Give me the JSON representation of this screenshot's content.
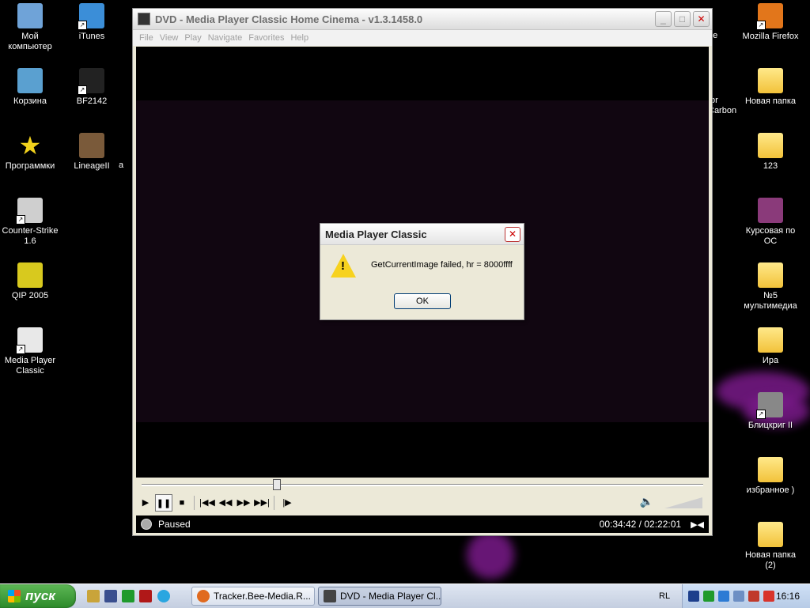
{
  "desktop": {
    "icons_left": [
      {
        "label": "Мой компьютер",
        "kind": "computer",
        "shortcut": false
      },
      {
        "label": "Корзина",
        "kind": "recycle",
        "shortcut": false
      },
      {
        "label": "Программки",
        "kind": "star",
        "shortcut": false
      },
      {
        "label": "Counter-Strike 1.6",
        "kind": "cs",
        "shortcut": true
      },
      {
        "label": "QIP 2005",
        "kind": "qip",
        "shortcut": false
      },
      {
        "label": "Media Player Classic",
        "kind": "mpc",
        "shortcut": true
      }
    ],
    "icons_col2": [
      {
        "label": "iTunes",
        "kind": "itunes",
        "shortcut": true
      },
      {
        "label": "BF2142",
        "kind": "bf",
        "shortcut": true
      },
      {
        "label": "LineageII",
        "kind": "lineage",
        "shortcut": false
      }
    ],
    "partial_left_text": "a",
    "partial_right": [
      {
        "text": "ne"
      },
      {
        "text": "for Carbon"
      }
    ],
    "icons_right": [
      {
        "label": "Mozilla Firefox",
        "kind": "firefox",
        "shortcut": true
      },
      {
        "label": "Новая папка",
        "kind": "folder",
        "shortcut": false
      },
      {
        "label": "123",
        "kind": "folder",
        "shortcut": false
      },
      {
        "label": "Курсовая по ОС",
        "kind": "rar",
        "shortcut": false
      },
      {
        "label": "№5 мультимедиа",
        "kind": "folder",
        "shortcut": false
      },
      {
        "label": "Ира",
        "kind": "folder",
        "shortcut": false
      },
      {
        "label": "Блицкриг II",
        "kind": "blitz",
        "shortcut": true
      },
      {
        "label": "избранное )",
        "kind": "folder",
        "shortcut": false
      },
      {
        "label": "Новая папка (2)",
        "kind": "folder",
        "shortcut": false
      }
    ]
  },
  "player": {
    "title": "DVD - Media Player Classic Home Cinema - v1.3.1458.0",
    "menu": [
      "File",
      "View",
      "Play",
      "Navigate",
      "Favorites",
      "Help"
    ],
    "seek_fraction": 0.24,
    "controls": [
      "play",
      "pause",
      "stop",
      "prev-chapter",
      "rewind",
      "fast-forward",
      "next-chapter",
      "frame-step"
    ],
    "status_text": "Paused",
    "time": "00:34:42 / 02:22:01"
  },
  "dialog": {
    "title": "Media Player Classic",
    "message": "GetCurrentImage failed, hr = 8000ffff",
    "ok_label": "OK"
  },
  "taskbar": {
    "start_label": "пуск",
    "tasks": [
      {
        "label": "Tracker.Bee-Media.R...",
        "icon": "firefox",
        "active": false
      },
      {
        "label": "DVD - Media Player Cl...",
        "icon": "mpc",
        "active": true
      }
    ],
    "lang": "RL",
    "clock": "16:16"
  }
}
